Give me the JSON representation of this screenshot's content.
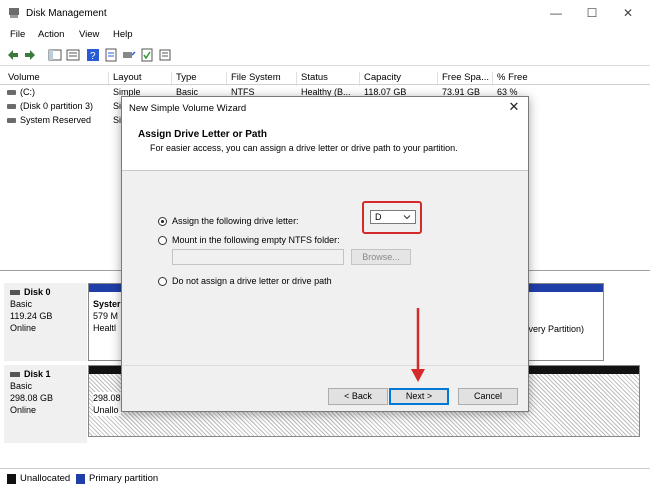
{
  "window": {
    "title": "Disk Management",
    "minimize": "—",
    "maximize": "☐",
    "close": "✕"
  },
  "menu": [
    "File",
    "Action",
    "View",
    "Help"
  ],
  "columns": [
    "Volume",
    "Layout",
    "Type",
    "File System",
    "Status",
    "Capacity",
    "Free Spa...",
    "% Free"
  ],
  "volumes": [
    {
      "name": "(C:)",
      "layout": "Simple",
      "type": "Basic",
      "fs": "NTFS",
      "status": "Healthy (B...",
      "capacity": "118.07 GB",
      "free": "73.91 GB",
      "pct": "63 %"
    },
    {
      "name": "(Disk 0 partition 3)",
      "layout": "Si"
    },
    {
      "name": "System Reserved",
      "layout": "Si"
    }
  ],
  "disks": [
    {
      "name": "Disk 0",
      "type": "Basic",
      "size": "119.24 GB",
      "state": "Online",
      "part1_title": "Syster",
      "part1_size": "579 M",
      "part1_status": "Healtl",
      "right_text": "covery Partition)"
    },
    {
      "name": "Disk 1",
      "type": "Basic",
      "size": "298.08 GB",
      "state": "Online",
      "part1_size": "298.08",
      "part1_status": "Unallo"
    }
  ],
  "legend": {
    "unallocated": "Unallocated",
    "primary": "Primary partition"
  },
  "dialog": {
    "title": "New Simple Volume Wizard",
    "close": "✕",
    "heading": "Assign Drive Letter or Path",
    "subheading": "For easier access, you can assign a drive letter or drive path to your partition.",
    "option_letter": "Assign the following drive letter:",
    "drive_letter": "D",
    "option_folder": "Mount in the following empty NTFS folder:",
    "folder_value": "",
    "browse": "Browse...",
    "option_none": "Do not assign a drive letter or drive path",
    "back": "< Back",
    "next": "Next >",
    "cancel": "Cancel"
  },
  "colors": {
    "highlight": "#d42a2a",
    "primary_partition": "#1f3ea8",
    "unallocated": "#111111",
    "accent": "#0078d7"
  },
  "icons": [
    "disk-management-icon",
    "back-arrow-icon",
    "forward-arrow-icon",
    "console-tree-icon",
    "help-icon",
    "properties-icon",
    "connect-icon",
    "check-icon",
    "list-icon",
    "drive-icon",
    "chevron-down-icon",
    "close-icon"
  ]
}
